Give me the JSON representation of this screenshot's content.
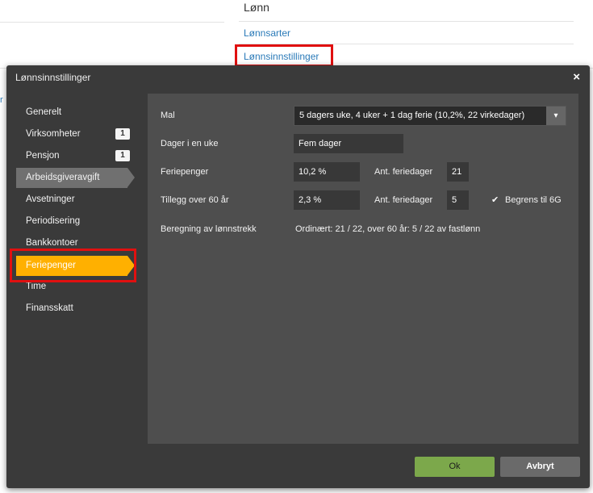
{
  "background": {
    "section_title": "Lønn",
    "links": [
      "Lønnsarter",
      "Lønnsinnstillinger"
    ],
    "left_fragment": "r"
  },
  "dialog": {
    "title": "Lønnsinnstillinger",
    "close": "×",
    "nav": [
      {
        "label": "Generelt",
        "badge": ""
      },
      {
        "label": "Virksomheter",
        "badge": "1"
      },
      {
        "label": "Pensjon",
        "badge": "1"
      },
      {
        "label": "Arbeidsgiveravgift",
        "badge": ""
      },
      {
        "label": "Avsetninger",
        "badge": ""
      },
      {
        "label": "Periodisering",
        "badge": ""
      },
      {
        "label": "Bankkontoer",
        "badge": ""
      },
      {
        "label": "Feriepenger",
        "badge": ""
      },
      {
        "label": "Time",
        "badge": ""
      },
      {
        "label": "Finansskatt",
        "badge": ""
      }
    ],
    "form": {
      "mal_label": "Mal",
      "mal_value": "5 dagers uke, 4 uker + 1 dag ferie (10,2%, 22 virkedager)",
      "mal_arrow": "▾",
      "dager_label": "Dager i en uke",
      "dager_value": "Fem dager",
      "feriepenger_label": "Feriepenger",
      "feriepenger_value": "10,2 %",
      "ant_label_1": "Ant. feriedager",
      "ant_value_1": "21",
      "tillegg_label": "Tillegg over 60 år",
      "tillegg_value": "2,3 %",
      "ant_label_2": "Ant. feriedager",
      "ant_value_2": "5",
      "begrens_check": "✔",
      "begrens_label": "Begrens til 6G",
      "beregning_label": "Beregning av lønnstrekk",
      "beregning_value": "Ordinært: 21 / 22, over 60 år: 5 / 22 av fastlønn"
    },
    "buttons": {
      "ok": "Ok",
      "cancel": "Avbryt"
    }
  },
  "colors": {
    "accent": "#ffb000",
    "ok": "#7ca84b",
    "highlight": "#e01010"
  }
}
